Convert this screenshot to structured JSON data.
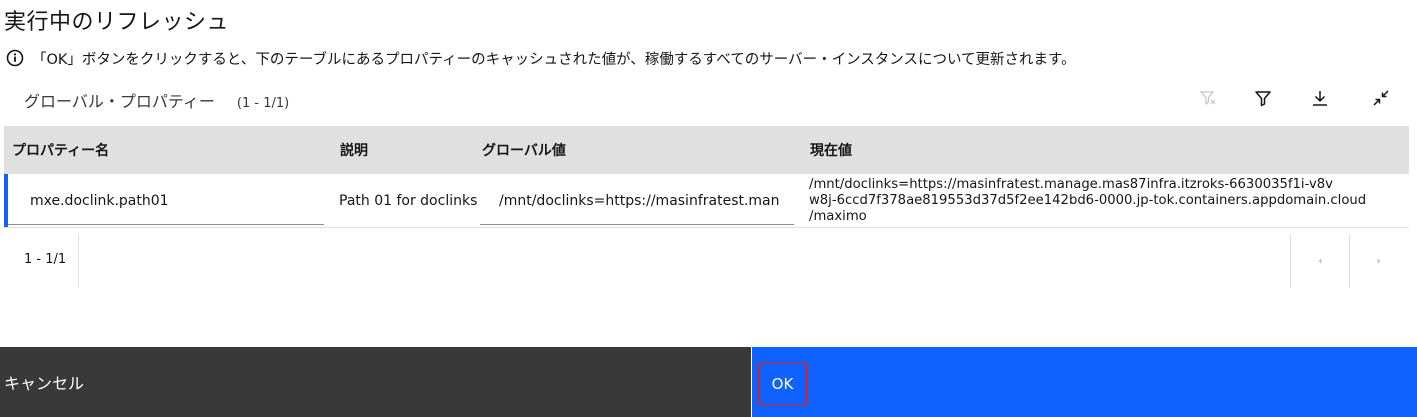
{
  "dialog": {
    "title": "実行中のリフレッシュ",
    "info_text": "「OK」ボタンをクリックすると、下のテーブルにあるプロパティーのキャッシュされた値が、稼働するすべてのサーバー・インスタンスについて更新されます。"
  },
  "table": {
    "title": "グローバル・プロパティー",
    "count": "(1 - 1/1)",
    "toolbar": {
      "clear_filter_icon": "clear-filter-icon",
      "filter_icon": "filter-icon",
      "download_icon": "download-icon",
      "collapse_icon": "collapse-icon"
    },
    "columns": [
      "プロパティー名",
      "説明",
      "グローバル値",
      "現在値"
    ],
    "rows": [
      {
        "property_name": "mxe.doclink.path01",
        "description": "Path 01 for doclinks",
        "global_value": "/mnt/doclinks=https://masinfratest.man",
        "current_value_line1": "/mnt/doclinks=https://masinfratest.manage.mas87infra.itzroks-6630035f1i-v8v",
        "current_value_line2": "w8j-6ccd7f378ae819553d37d5f2ee142bd6-0000.jp-tok.containers.appdomain.cloud",
        "current_value_line3": "/maximo"
      }
    ],
    "pager": {
      "range": "1 - 1/1"
    }
  },
  "footer": {
    "cancel_label": "キャンセル",
    "ok_label": "OK"
  },
  "colors": {
    "primary": "#0f62fe",
    "secondary": "#393939",
    "header_bg": "#e0e0e0",
    "focus_outline": "#da1e28"
  }
}
